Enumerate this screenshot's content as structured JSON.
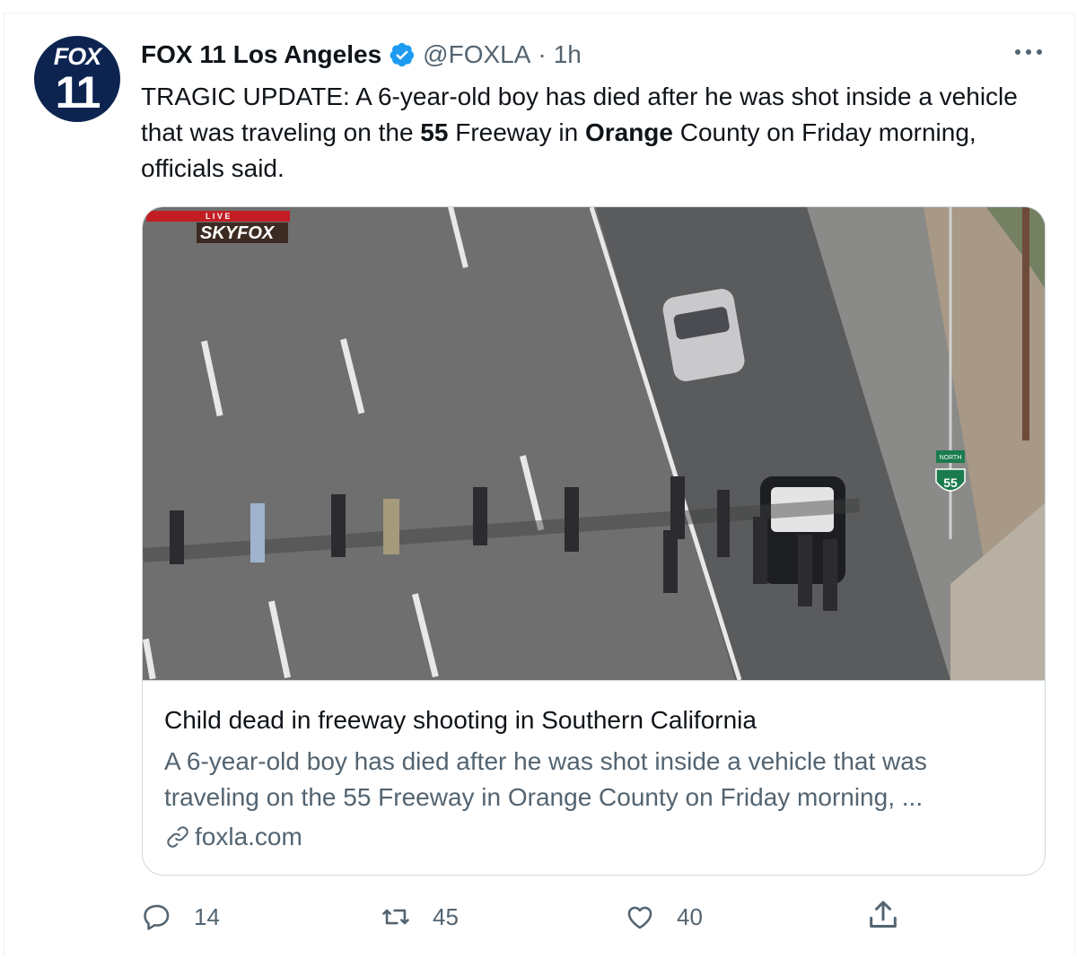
{
  "account": {
    "logo_text_top": "FOX",
    "logo_text_bottom": "11",
    "name": "FOX 11 Los Angeles",
    "handle": "@FOXLA",
    "separator": "·",
    "time": "1h"
  },
  "tweet": {
    "text_part1": "TRAGIC UPDATE: A 6-year-old boy has died after he was shot inside a vehicle that was traveling on the ",
    "bold1": "55",
    "text_part2": " Freeway in ",
    "bold2": "Orange",
    "text_part3": " County on Friday morning, officials said."
  },
  "card": {
    "image_overlay_live": "L I V E",
    "image_overlay_brand": "SKYFOX",
    "image_sign_text": "NORTH",
    "image_sign_number": "55",
    "title": "Child dead in freeway shooting in Southern California",
    "description": "A 6-year-old boy has died after he was shot inside a vehicle that was traveling on the 55 Freeway in Orange County on Friday morning, ...",
    "domain": "foxla.com"
  },
  "actions": {
    "replies": "14",
    "retweets": "45",
    "likes": "40"
  },
  "colors": {
    "verified_blue": "#1d9bf0",
    "secondary_text": "#536471",
    "primary_text": "#0f1419",
    "logo_navy": "#0d2451",
    "card_border": "#cfd9de"
  },
  "icons": {
    "verified": "verified-badge-icon",
    "more": "more-options-icon",
    "reply": "reply-icon",
    "retweet": "retweet-icon",
    "like": "heart-icon",
    "share": "share-icon",
    "link": "link-icon"
  }
}
